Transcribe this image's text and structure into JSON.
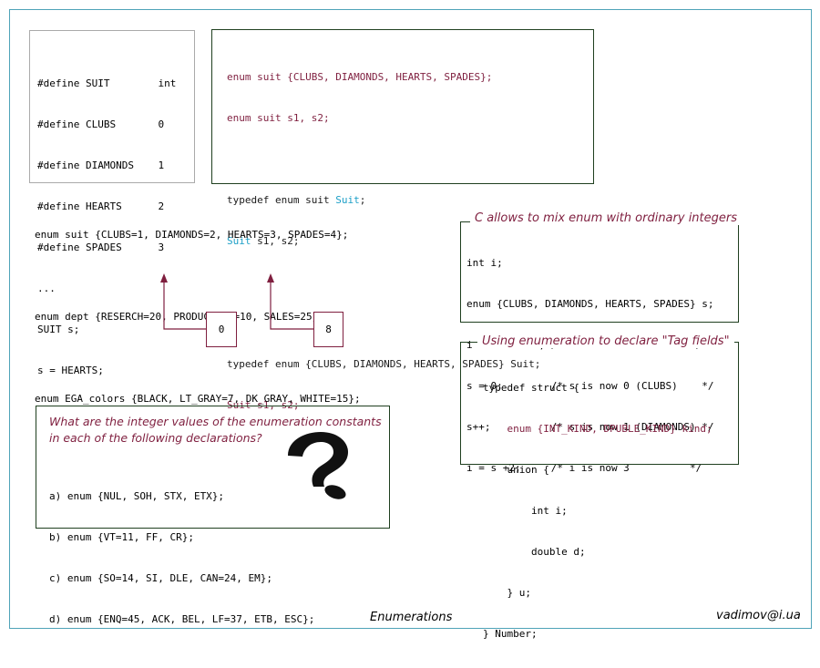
{
  "box_define": {
    "lines": [
      "#define SUIT        int",
      "#define CLUBS       0",
      "#define DIAMONDS    1",
      "#define HEARTS      2",
      "#define SPADES      3",
      "...",
      "SUIT s;",
      "s = HEARTS;"
    ]
  },
  "box_typedef": {
    "line1": "enum suit {CLUBS, DIAMONDS, HEARTS, SPADES};",
    "line2": "enum suit s1, s2;",
    "line3_pre": "typedef enum suit ",
    "line3_type": "Suit",
    "line3_post": ";",
    "line4_type": "Suit",
    "line4_post": " s1, s2;",
    "line5": "typedef enum {CLUBS, DIAMONDS, HEARTS, SPADES} Suit;",
    "line6": "Suit s1, s2;"
  },
  "enum_examples": {
    "line1": "enum suit {CLUBS=1, DIAMONDS=2, HEARTS=3, SPADES=4};",
    "line2": "enum dept {RESERCH=20, PRODUCTION=10, SALES=25};",
    "line3": "enum EGA_colors {BLACK, LT_GRAY=7, DK_GRAY, WHITE=15};",
    "value_black": "0",
    "value_dkgray": "8"
  },
  "mix_box": {
    "caption": "C allows to mix enum with ordinary integers",
    "lines": [
      "int i;",
      "enum {CLUBS, DIAMONDS, HEARTS, SPADES} s;",
      "i = DIAMONDS; /* i is now 1          */",
      "s = 0;        /* s is now 0 (CLUBS)    */",
      "s++;          /* s is now 1 (DIAMONDS) */",
      "i = s +2;     /* i is now 3          */"
    ]
  },
  "tag_box": {
    "caption": "Using enumeration to declare \"Tag fields\"",
    "lines": [
      "typedef struct {",
      "    enum {INT_KIND, DPUBLE_KIND} kind;",
      "    union {",
      "        int i;",
      "        double d;",
      "    } u;",
      "} Number;"
    ]
  },
  "question_box": {
    "question_line1": "What are the integer values of the enumeration constants",
    "question_line2": "in each of the following declarations?",
    "items": [
      "a) enum {NUL, SOH, STX, ETX};",
      "b) enum {VT=11, FF, CR};",
      "c) enum {SO=14, SI, DLE, CAN=24, EM};",
      "d) enum {ENQ=45, ACK, BEL, LF=37, ETB, ESC};"
    ],
    "icon": "question-mark-icon"
  },
  "footer": {
    "title": "Enumerations",
    "author": "vadimov@i.ua"
  },
  "colors": {
    "frame": "#4fa3b8",
    "accent": "#7f1f3f",
    "type_highlight": "#1b9fc7",
    "box_border_green": "#1f3f1f"
  }
}
